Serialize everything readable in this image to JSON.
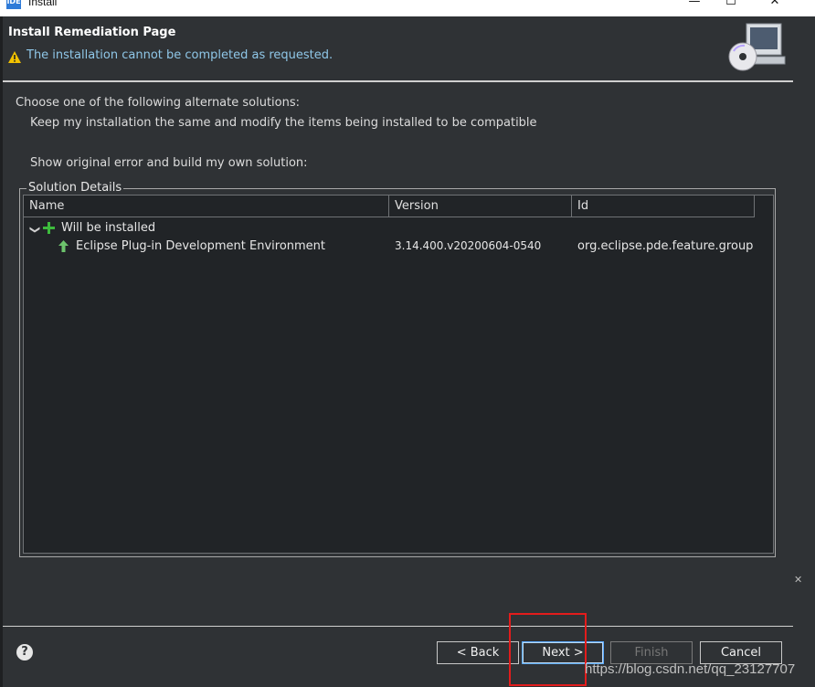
{
  "window": {
    "title": "Install",
    "app_icon_text": "IDE"
  },
  "header": {
    "title": "Install Remediation Page",
    "message": "The installation cannot be completed as requested."
  },
  "body": {
    "prompt": "Choose one of the following alternate solutions:",
    "option_1": "Keep my installation the same and modify the items being installed to be compatible",
    "option_2": "Show original error and build my own solution:"
  },
  "details": {
    "group_label": "Solution Details",
    "columns": [
      "Name",
      "Version",
      "Id"
    ],
    "group_row": "Will be installed",
    "items": [
      {
        "name": "Eclipse Plug-in Development Environment",
        "version": "3.14.400.v20200604-0540",
        "id": "org.eclipse.pde.feature.group"
      }
    ]
  },
  "buttons": {
    "help": "?",
    "back": "< Back",
    "next": "Next >",
    "finish": "Finish",
    "cancel": "Cancel"
  },
  "watermark": "https://blog.csdn.net/qq_23127707",
  "colors": {
    "background": "#2f3235",
    "highlight": "#e31c1c",
    "message": "#8fc7e8"
  }
}
